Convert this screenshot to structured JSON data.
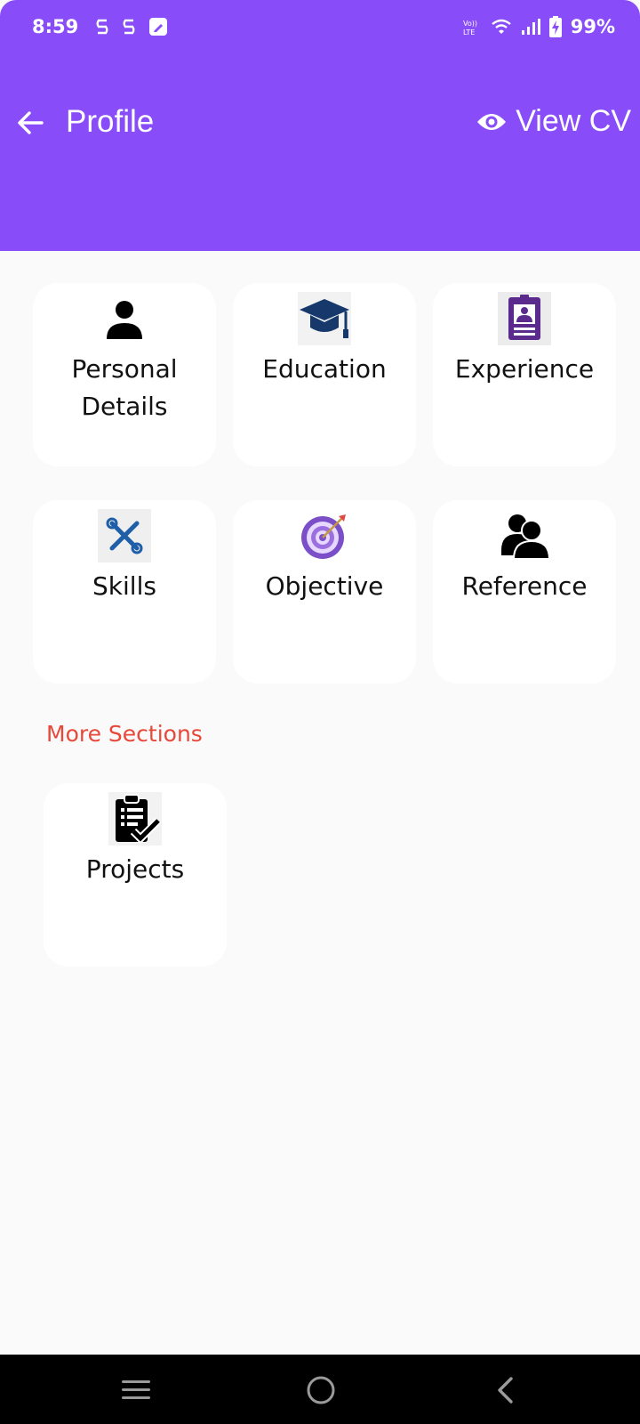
{
  "status_bar": {
    "time": "8:59",
    "battery": "99%"
  },
  "app_bar": {
    "title": "Profile",
    "view_cv_label": "View CV",
    "background": "#884cf8"
  },
  "sections": [
    {
      "label": "Personal Details",
      "icon": "person-icon"
    },
    {
      "label": "Education",
      "icon": "graduation-cap-icon"
    },
    {
      "label": "Experience",
      "icon": "id-badge-icon"
    },
    {
      "label": "Skills",
      "icon": "tools-icon"
    },
    {
      "label": "Objective",
      "icon": "target-icon"
    },
    {
      "label": "Reference",
      "icon": "people-icon"
    }
  ],
  "more_sections": {
    "title": "More Sections",
    "title_color": "#e8483a",
    "items": [
      {
        "label": "Projects",
        "icon": "clipboard-check-icon"
      }
    ]
  }
}
